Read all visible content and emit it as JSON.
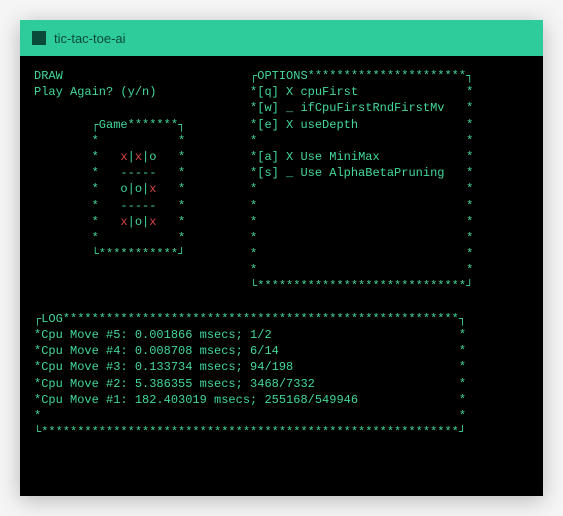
{
  "window": {
    "title": "tic-tac-toe-ai"
  },
  "status": {
    "result": "DRAW",
    "prompt": "Play Again? (y/n)"
  },
  "game": {
    "title": "Game",
    "board": [
      [
        "x",
        "x",
        "o"
      ],
      [
        "o",
        "o",
        "x"
      ],
      [
        "x",
        "o",
        "x"
      ]
    ]
  },
  "options": {
    "title": "OPTIONS",
    "items": [
      {
        "key": "[q]",
        "mark": "X",
        "label": "cpuFirst"
      },
      {
        "key": "[w]",
        "mark": "_",
        "label": "ifCpuFirstRndFirstMv"
      },
      {
        "key": "[e]",
        "mark": "X",
        "label": "useDepth"
      },
      {
        "spacer": true
      },
      {
        "key": "[a]",
        "mark": "X",
        "label": "Use MiniMax"
      },
      {
        "key": "[s]",
        "mark": "_",
        "label": "Use AlphaBetaPruning"
      }
    ]
  },
  "log": {
    "title": "LOG",
    "entries": [
      "Cpu Move #5: 0.001866 msecs; 1/2",
      "Cpu Move #4: 0.008708 msecs; 6/14",
      "Cpu Move #3: 0.133734 msecs; 94/198",
      "Cpu Move #2: 5.386355 msecs; 3468/7332",
      "Cpu Move #1: 182.403019 msecs; 255168/549946"
    ]
  }
}
